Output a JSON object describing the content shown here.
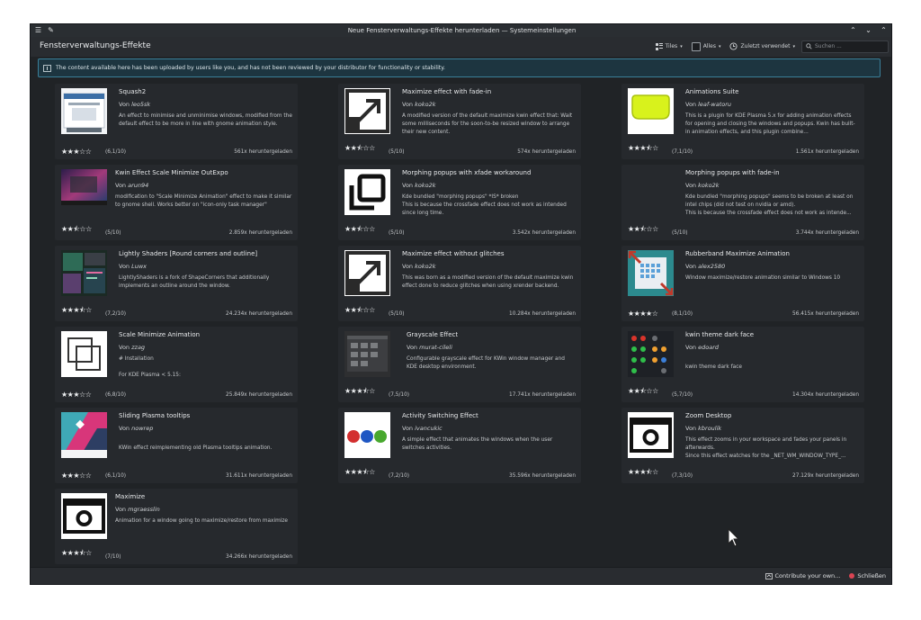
{
  "window": {
    "title": "Neue Fensterverwaltungs-Effekte herunterladen — Systemeinstellungen"
  },
  "header": {
    "page_title": "Fensterverwaltungs-Effekte",
    "view_label": "Tiles",
    "filter_label": "Alles",
    "sort_label": "Zuletzt verwendet",
    "search_placeholder": "Suchen ..."
  },
  "banner": {
    "text": "The content available here has been uploaded by users like you, and has not been reviewed by your distributor for functionality or stability."
  },
  "items": [
    {
      "name": "Squash2",
      "author_prefix": "Von",
      "author": "leo5sk",
      "description": "An effect to minimise and unminimise windows, modified from the default effect to be more in line with gnome animation style.",
      "stars": "★★★☆☆",
      "score": "(6,1/10)",
      "downloads": "561x heruntergeladen",
      "icon": "squash-window-icon"
    },
    {
      "name": "Maximize effect with fade-in",
      "author_prefix": "Von",
      "author": "koko2k",
      "description": "A modified version of the default maximize kwin effect that: Wait some milliseconds for the soon-to-be resized window to arrange their new content.",
      "stars": "★★⯪☆☆",
      "score": "(5/10)",
      "downloads": "574x heruntergeladen",
      "icon": "maximize-arrow-icon"
    },
    {
      "name": "Animations Suite",
      "author_prefix": "Von",
      "author": "leaf-watoru",
      "description": "This is a plugin for KDE Plasma 5.x for adding animation effects for opening and closing the windows and popups. Kwin has built-in animation effects, and this plugin combine...",
      "stars": "★★★⯪☆",
      "score": "(7,1/10)",
      "downloads": "1.561x heruntergeladen",
      "icon": "yellow-window-icon"
    },
    {
      "name": "Kwin Effect Scale Minimize OutExpo",
      "author_prefix": "Von",
      "author": "arun94",
      "description": "modification to \"Scale Minimize Animation\" effect to make it similar to gnome shell. Works better on \"icon-only task manager\"",
      "stars": "★★⯪☆☆",
      "score": "(5/10)",
      "downloads": "2.859x heruntergeladen",
      "icon": "desktop-screenshot-icon"
    },
    {
      "name": "Morphing popups with xfade workaround",
      "author_prefix": "Von",
      "author": "koko2k",
      "description": "Kde bundled \"morphing popups\" *IS* broken\nThis is because the crossfade effect does not work as intended since long time.",
      "stars": "★★⯪☆☆",
      "score": "(5/10)",
      "downloads": "3.542x heruntergeladen",
      "icon": "overlapping-squares-icon"
    },
    {
      "name": "Morphing popups with fade-in",
      "author_prefix": "Von",
      "author": "koko2k",
      "description": "Kde bundled \"morphing popups\" seems to be broken at least on intel chips (did not test on nvidia or amd).\nThis is because the crossfade effect does not work as intende...",
      "stars": "★★⯪☆☆",
      "score": "(5/10)",
      "downloads": "3.744x heruntergeladen",
      "icon": ""
    },
    {
      "name": "Lightly Shaders [Round corners and outline]",
      "author_prefix": "Von",
      "author": "Luwx",
      "description": "LightlyShaders is a fork of ShapeCorners that additionally implements an outline around the window.",
      "stars": "★★★⯪☆",
      "score": "(7,2/10)",
      "downloads": "24.234x heruntergeladen",
      "icon": "dark-desktop-icon"
    },
    {
      "name": "Maximize effect without glitches",
      "author_prefix": "Von",
      "author": "koko2k",
      "description": "This was born as a modified version of the default maximize kwin effect done to reduce glitches when using xrender backend.",
      "stars": "★★⯪☆☆",
      "score": "(5/10)",
      "downloads": "10.284x heruntergeladen",
      "icon": "maximize-arrow-icon"
    },
    {
      "name": "Rubberband Maximize Animation",
      "author_prefix": "Von",
      "author": "alex2580",
      "description": "Window maximize/restore animation similar to Windows 10",
      "stars": "★★★★☆",
      "score": "(8,1/10)",
      "downloads": "56.415x heruntergeladen",
      "icon": "rubberband-icon"
    },
    {
      "name": "Scale Minimize Animation",
      "author_prefix": "Von",
      "author": "zzag",
      "description": "# Installation\n\nFor KDE Plasma < 5.15:",
      "stars": "★★★☆☆",
      "score": "(6,8/10)",
      "downloads": "25.849x heruntergeladen",
      "icon": "scale-squares-icon"
    },
    {
      "name": "Grayscale Effect",
      "author_prefix": "Von",
      "author": "murat-cileli",
      "description": "Configurable grayscale effect for KWin window manager and KDE desktop environment.",
      "stars": "★★★⯪☆",
      "score": "(7,5/10)",
      "downloads": "17.741x heruntergeladen",
      "icon": "grayscale-screenshot-icon"
    },
    {
      "name": "kwin theme dark face",
      "author_prefix": "Von",
      "author": "edoard",
      "description": "\nkwin theme dark face",
      "stars": "★★⯪☆☆",
      "score": "(5,7/10)",
      "downloads": "14.304x heruntergeladen",
      "icon": "dark-face-buttons-icon"
    },
    {
      "name": "Sliding Plasma tooltips",
      "author_prefix": "Von",
      "author": "nowrep",
      "description": "\nKWin effect reimplementing old Plasma tooltips animation.",
      "stars": "★★★☆☆",
      "score": "(6,1/10)",
      "downloads": "31.611x heruntergeladen",
      "icon": "colorful-tooltip-icon"
    },
    {
      "name": "Activity Switching Effect",
      "author_prefix": "Von",
      "author": "ivancukic",
      "description": "A simple effect that animates the windows when the user switches activities.",
      "stars": "★★★⯪☆",
      "score": "(7,2/10)",
      "downloads": "35.596x heruntergeladen",
      "icon": "three-balls-icon"
    },
    {
      "name": "Zoom Desktop",
      "author_prefix": "Von",
      "author": "kbroulik",
      "description": "This effect zooms in your workspace and fades your panels in afterwards.\nSince this effect watches for the _NET_WM_WINDOW_TYPE_...",
      "stars": "★★★⯪☆",
      "score": "(7,3/10)",
      "downloads": "27.129x heruntergeladen",
      "icon": "camera-icon"
    },
    {
      "name": "Maximize",
      "author_prefix": "Von",
      "author": "mgraesslin",
      "description": "Animation for a window going to maximize/restore from maximize",
      "stars": "★★★⯪☆",
      "score": "(7/10)",
      "downloads": "34.266x heruntergeladen",
      "icon": "camera-icon"
    }
  ],
  "footer": {
    "contribute_label": "Contribute your own...",
    "close_label": "Schließen"
  },
  "colors": {
    "background": "#202326",
    "card": "#26292d",
    "banner_border": "#3a7f99",
    "close": "#da4453"
  }
}
